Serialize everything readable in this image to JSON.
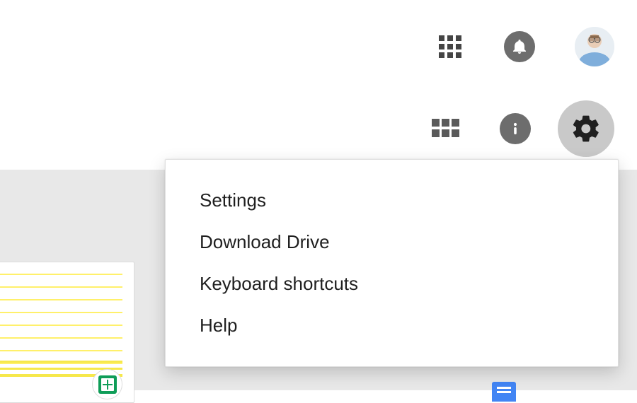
{
  "menu": {
    "items": [
      "Settings",
      "Download Drive",
      "Keyboard shortcuts",
      "Help"
    ]
  }
}
